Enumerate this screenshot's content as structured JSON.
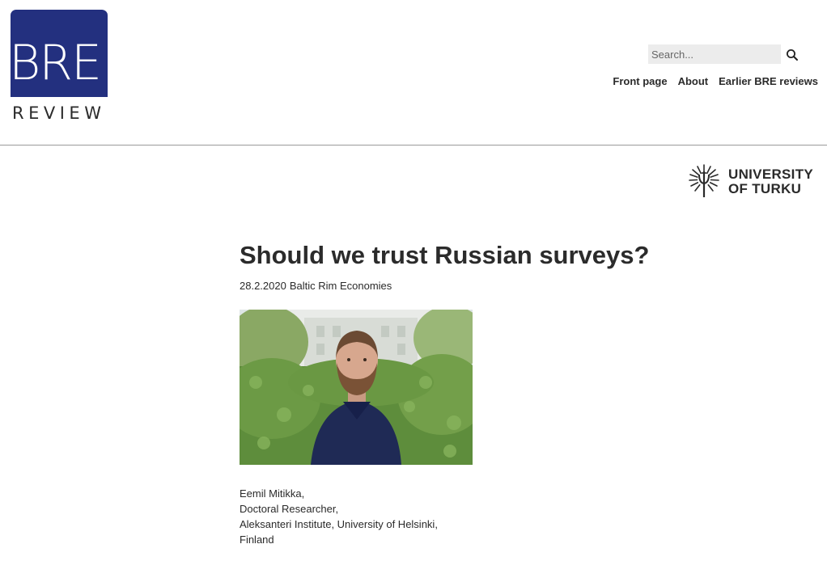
{
  "header": {
    "logo": {
      "letters": "BRE",
      "word": "REVIEW",
      "color": "#23307f"
    },
    "search": {
      "placeholder": "Search...",
      "icon": "search-icon"
    },
    "nav": [
      {
        "label": "Front page"
      },
      {
        "label": "About"
      },
      {
        "label": "Earlier BRE reviews"
      }
    ]
  },
  "sponsor": {
    "line1": "UNIVERSITY",
    "line2": "OF TURKU"
  },
  "article": {
    "title": "Should we trust Russian surveys?",
    "date": "28.2.2020",
    "category": "Baltic Rim Economies",
    "author_lines": [
      "Eemil Mitikka,",
      "Doctoral Researcher,",
      "Aleksanteri Institute, University of Helsinki,",
      "Finland"
    ]
  }
}
